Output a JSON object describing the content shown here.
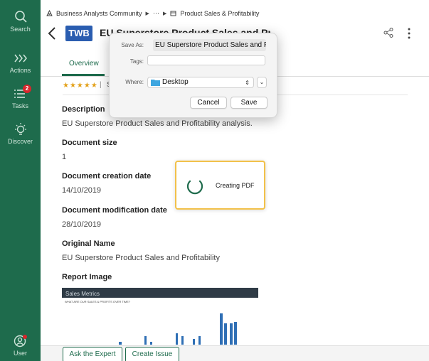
{
  "sidebar": {
    "items": [
      {
        "label": "Search",
        "icon": "search-icon"
      },
      {
        "label": "Actions",
        "icon": "chevrons-right-icon"
      },
      {
        "label": "Tasks",
        "icon": "tasks-icon",
        "badge": "2"
      },
      {
        "label": "Discover",
        "icon": "lightbulb-icon"
      },
      {
        "label": "User",
        "icon": "user-icon"
      }
    ],
    "color": "#1e6b4c"
  },
  "breadcrumb": {
    "items": [
      "Business Analysts Community",
      "⋯",
      "Product Sales & Profitability"
    ]
  },
  "header": {
    "badge": "TWB",
    "title": "EU Superstore Product Sales and Profitability"
  },
  "tabs": [
    "Overview"
  ],
  "rating": {
    "stars": "★★★★★",
    "text": "S"
  },
  "fields": [
    {
      "label": "Description",
      "value": "EU Superstore Product Sales and Profitability analysis."
    },
    {
      "label": "Document size",
      "value": "1"
    },
    {
      "label": "Document creation date",
      "value": "14/10/2019"
    },
    {
      "label": "Document modification date",
      "value": "28/10/2019"
    },
    {
      "label": "Original Name",
      "value": "EU Superstore Product Sales and Profitability"
    },
    {
      "label": "Report Image",
      "value": ""
    }
  ],
  "report_image": {
    "title": "Sales Metrics",
    "subtitle": "WHAT ARE OUR SALES & PROFITS OVER TIME?"
  },
  "bottom": {
    "ask": "Ask the Expert",
    "issue": "Create Issue"
  },
  "creating_pdf": {
    "text": "Creating PDF"
  },
  "save_dialog": {
    "save_as_label": "Save As:",
    "save_as_value": "EU Superstore Product Sales and P",
    "tags_label": "Tags:",
    "where_label": "Where:",
    "where_value": "Desktop",
    "cancel": "Cancel",
    "save": "Save"
  }
}
